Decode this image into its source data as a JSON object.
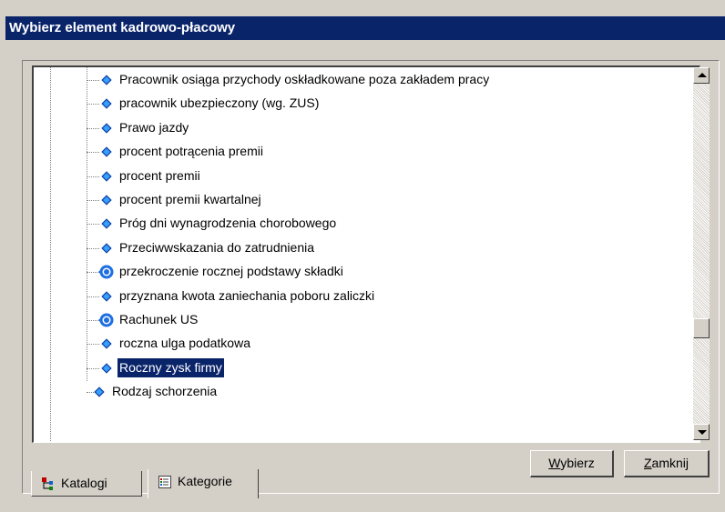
{
  "window": {
    "title": "Wybierz element kadrowo-płacowy"
  },
  "tree": {
    "items": [
      {
        "label": "Pracownik osiąga przychody oskładkowane poza zakładem pracy",
        "icon": "blue-diamond-icon",
        "selected": false
      },
      {
        "label": "pracownik ubezpieczony (wg. ZUS)",
        "icon": "blue-diamond-icon",
        "selected": false
      },
      {
        "label": "Prawo jazdy",
        "icon": "blue-diamond-icon",
        "selected": false
      },
      {
        "label": "procent potrącenia premii",
        "icon": "blue-diamond-icon",
        "selected": false
      },
      {
        "label": "procent premii",
        "icon": "blue-diamond-icon",
        "selected": false
      },
      {
        "label": "procent premii kwartalnej",
        "icon": "blue-diamond-icon",
        "selected": false
      },
      {
        "label": "Próg dni wynagrodzenia chorobowego",
        "icon": "blue-diamond-icon",
        "selected": false
      },
      {
        "label": "Przeciwwskazania do zatrudnienia",
        "icon": "blue-diamond-icon",
        "selected": false
      },
      {
        "label": "przekroczenie rocznej podstawy składki",
        "icon": "blue-target-icon",
        "selected": false
      },
      {
        "label": "przyznana kwota zaniechania poboru zaliczki",
        "icon": "blue-diamond-icon",
        "selected": false
      },
      {
        "label": "Rachunek US",
        "icon": "blue-target-icon",
        "selected": false
      },
      {
        "label": "roczna ulga podatkowa",
        "icon": "blue-diamond-icon",
        "selected": false
      },
      {
        "label": "Roczny zysk firmy",
        "icon": "blue-diamond-icon",
        "selected": true
      },
      {
        "label": "Rodzaj schorzenia",
        "icon": "blue-diamond-icon",
        "selected": false
      }
    ]
  },
  "buttons": {
    "select_underline": "W",
    "select_rest": "ybierz",
    "close_underline": "Z",
    "close_rest": "amknij"
  },
  "tabs": [
    {
      "label": "Katalogi",
      "icon": "tree-catalog-icon",
      "active": false
    },
    {
      "label": "Kategorie",
      "icon": "category-list-icon",
      "active": true
    }
  ],
  "colors": {
    "titlebar": "#0a246a",
    "selection": "#0a246a",
    "icon_blue": "#1e6fe0",
    "background": "#d4d0c8"
  }
}
